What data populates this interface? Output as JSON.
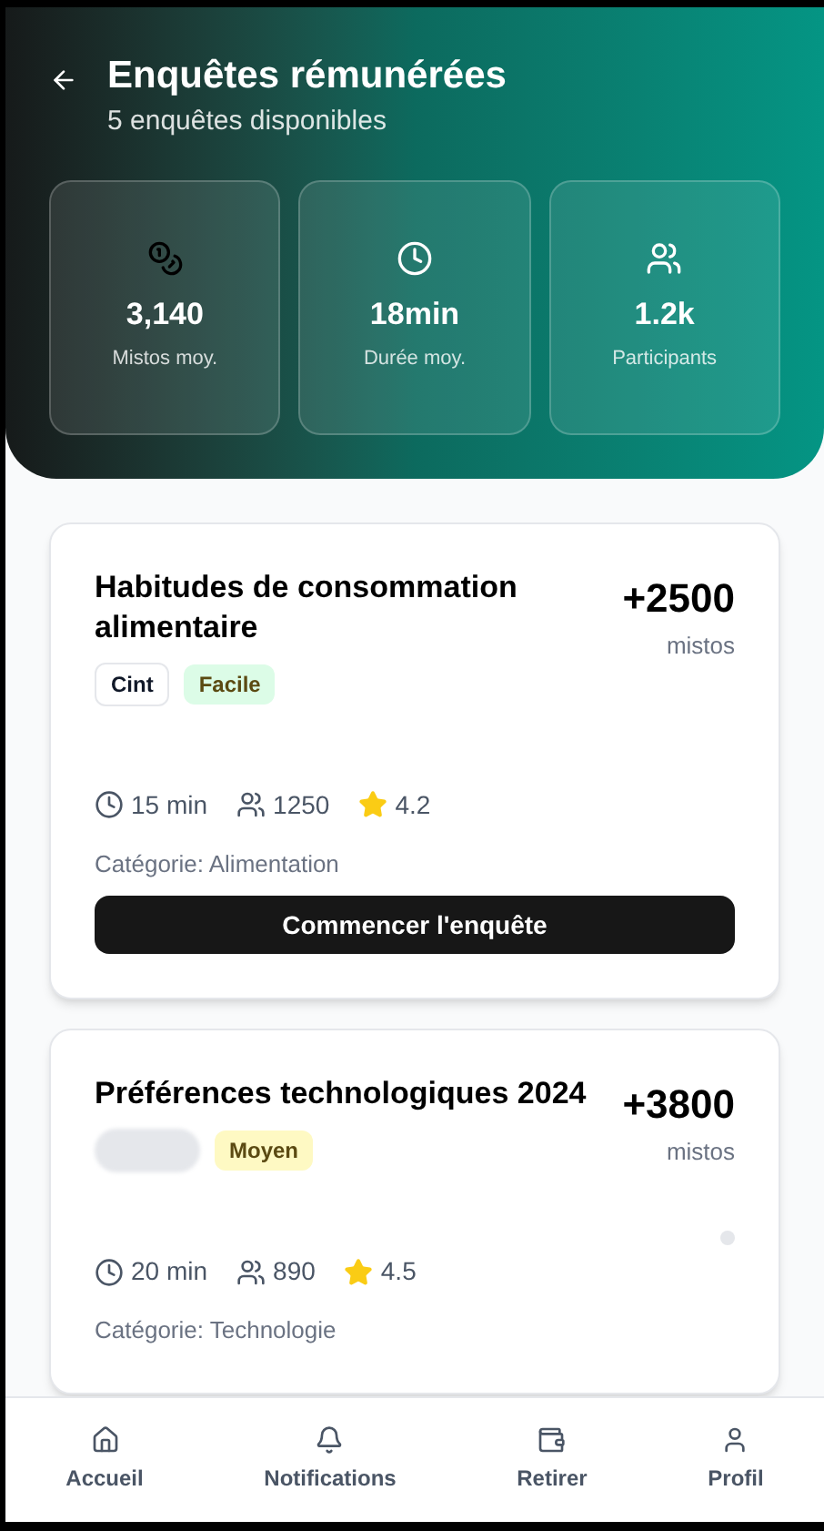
{
  "header": {
    "title": "Enquêtes rémunérées",
    "subtitle": "5 enquêtes disponibles"
  },
  "stats": [
    {
      "value": "3,140",
      "label": "Mistos moy."
    },
    {
      "value": "18min",
      "label": "Durée moy."
    },
    {
      "value": "1.2k",
      "label": "Participants"
    }
  ],
  "surveys": [
    {
      "title": "Habitudes de consommation alimentaire",
      "reward": "+2500",
      "reward_unit": "mistos",
      "badges": [
        {
          "kind": "provider",
          "label": "Cint"
        },
        {
          "kind": "difficulty",
          "label": "Facile",
          "color": "#dcfce7"
        }
      ],
      "loading_dot": false,
      "duration": "15 min",
      "participants": "1250",
      "rating": "4.2",
      "category": "Catégorie: Alimentation",
      "button": "Commencer l'enquête"
    },
    {
      "title": "Préférences technologiques 2024",
      "reward": "+3800",
      "reward_unit": "mistos",
      "badges": [
        {
          "kind": "placeholder"
        },
        {
          "kind": "difficulty",
          "label": "Moyen",
          "color": "#fef9c3"
        }
      ],
      "loading_dot": true,
      "duration": "20 min",
      "participants": "890",
      "rating": "4.5",
      "category": "Catégorie: Technologie"
    }
  ],
  "nav": [
    {
      "label": "Accueil"
    },
    {
      "label": "Notifications"
    },
    {
      "label": "Retirer"
    },
    {
      "label": "Profil"
    }
  ]
}
